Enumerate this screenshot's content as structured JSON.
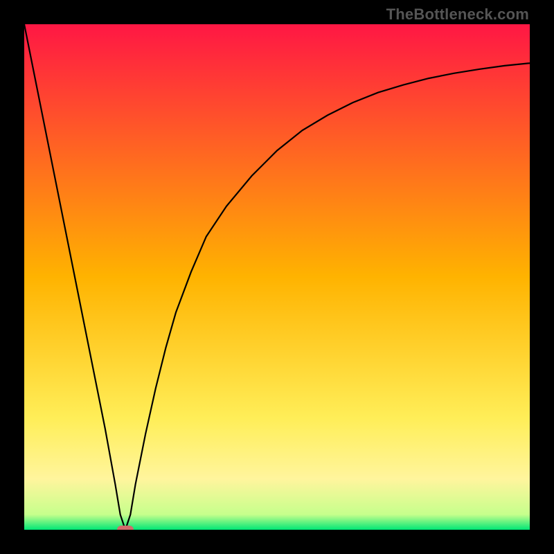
{
  "watermark": "TheBottleneck.com",
  "chart_data": {
    "type": "line",
    "title": "",
    "xlabel": "",
    "ylabel": "",
    "xlim": [
      0,
      100
    ],
    "ylim": [
      0,
      100
    ],
    "grid": false,
    "legend": false,
    "background_gradient": {
      "stops": [
        {
          "offset": 0.0,
          "color": "#ff1744"
        },
        {
          "offset": 0.5,
          "color": "#ffb300"
        },
        {
          "offset": 0.78,
          "color": "#ffee58"
        },
        {
          "offset": 0.9,
          "color": "#fff59d"
        },
        {
          "offset": 0.97,
          "color": "#c6ff8c"
        },
        {
          "offset": 1.0,
          "color": "#00e676"
        }
      ]
    },
    "marker": {
      "x": 20,
      "y": 0,
      "color": "#d16b6b",
      "shape": "pill"
    },
    "series": [
      {
        "name": "curve",
        "color": "#000000",
        "x": [
          0,
          2,
          4,
          6,
          8,
          10,
          12,
          14,
          16,
          18,
          19,
          20,
          21,
          22,
          24,
          26,
          28,
          30,
          33,
          36,
          40,
          45,
          50,
          55,
          60,
          65,
          70,
          75,
          80,
          85,
          90,
          95,
          100
        ],
        "y": [
          100,
          90,
          80,
          70,
          60,
          50,
          40,
          30,
          20,
          9,
          3,
          0,
          3,
          9,
          19,
          28,
          36,
          43,
          51,
          58,
          64,
          70,
          75,
          79,
          82,
          84.5,
          86.5,
          88,
          89.3,
          90.3,
          91.1,
          91.8,
          92.3
        ]
      }
    ]
  }
}
